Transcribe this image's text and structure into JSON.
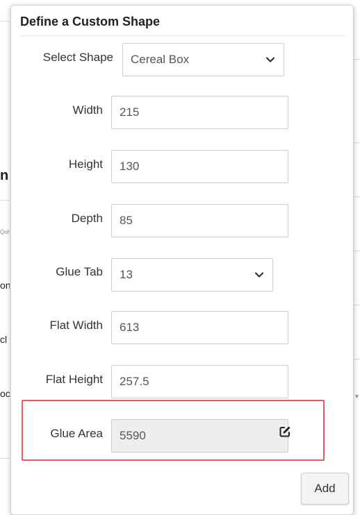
{
  "dialog": {
    "title": "Define a Custom Shape",
    "fields": {
      "select_shape": {
        "label": "Select Shape",
        "value": "Cereal Box"
      },
      "width": {
        "label": "Width",
        "value": "215"
      },
      "height": {
        "label": "Height",
        "value": "130"
      },
      "depth": {
        "label": "Depth",
        "value": "85"
      },
      "glue_tab": {
        "label": "Glue Tab",
        "value": "13"
      },
      "flat_width": {
        "label": "Flat Width",
        "value": "613"
      },
      "flat_height": {
        "label": "Flat Height",
        "value": "257.5"
      },
      "glue_area": {
        "label": "Glue Area",
        "value": "5590"
      }
    },
    "add_label": "Add",
    "icons": {
      "select_arrow": "chevron-down-icon",
      "edit": "edit-icon"
    }
  },
  "background": {
    "fragments": [
      "n",
      "Qoh",
      "on",
      "cl",
      "oc"
    ]
  },
  "colors": {
    "highlight": "#e05a5f",
    "readonly_bg": "#eeeeee"
  }
}
